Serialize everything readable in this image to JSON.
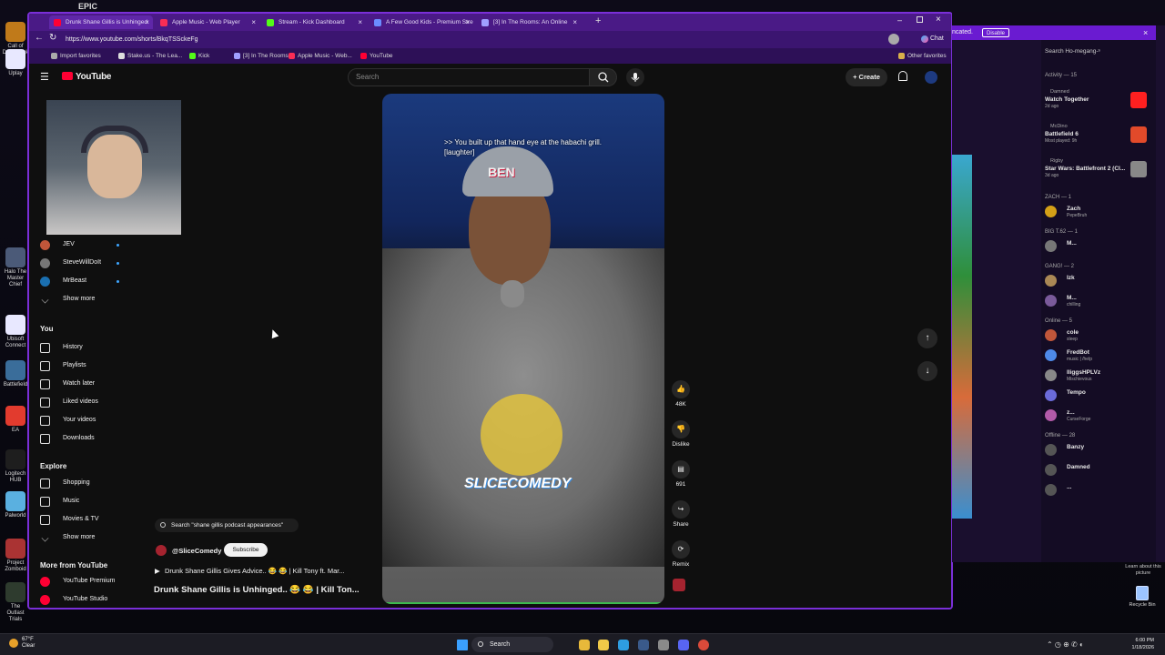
{
  "desktop": {
    "top_label": "EPIC",
    "icons": [
      {
        "label": "Call of Duty Black Ops",
        "color": "#c07a1a"
      },
      {
        "label": "Uplay",
        "color": "#e8e8ff"
      },
      {
        "label": "Halo The Master Chief",
        "color": "#4b5a78"
      },
      {
        "label": "Ubisoft Connect",
        "color": "#e8e8ff"
      },
      {
        "label": "Battlefield",
        "color": "#3a6d9a"
      },
      {
        "label": "EA",
        "color": "#e23b2e"
      },
      {
        "label": "Logitech HUB",
        "color": "#1e1e1e"
      },
      {
        "label": "Palworld",
        "color": "#5ab0e0"
      },
      {
        "label": "Project Zomboid",
        "color": "#a33"
      },
      {
        "label": "The Outlast Trials",
        "color": "#2e3b2e"
      }
    ],
    "recycle_bin": "Recycle Bin",
    "learn_more": "Learn about this picture"
  },
  "browser": {
    "tabs": [
      {
        "label": "Drunk Shane Gillis is Unhinged",
        "color": "#ff0033",
        "active": true
      },
      {
        "label": "Apple Music - Web Player",
        "color": "#fa2d55",
        "active": false
      },
      {
        "label": "Stream - Kick Dashboard",
        "color": "#53fc18",
        "active": false
      },
      {
        "label": "A Few Good Kids - Premium Stre",
        "color": "#6b8cff",
        "active": false
      },
      {
        "label": "[3] In The Rooms: An Online",
        "color": "#a0a0ff",
        "active": false
      }
    ],
    "url": "https://www.youtube.com/shorts/BkqTSSckeFg",
    "chat_label": "Chat",
    "bookmarks": [
      {
        "label": "Import favorites",
        "color": "#aaa"
      },
      {
        "label": "Stake.us - The Lea...",
        "color": "#ddd"
      },
      {
        "label": "Kick",
        "color": "#53fc18"
      },
      {
        "label": "[3] In The Rooms:...",
        "color": "#a0a0ff"
      },
      {
        "label": "Apple Music - Web...",
        "color": "#fa2d55"
      },
      {
        "label": "YouTube",
        "color": "#ff0033"
      }
    ],
    "other_favorites": "Other favorites"
  },
  "youtube": {
    "logo": "YouTube",
    "search_placeholder": "Search",
    "create_label": "Create",
    "subs": [
      {
        "name": "JEV",
        "color": "#c0563a"
      },
      {
        "name": "SteveWillDoIt",
        "color": "#777"
      },
      {
        "name": "MrBeast",
        "color": "#1a6fb0"
      }
    ],
    "show_more": "Show more",
    "you_label": "You",
    "you_items": [
      {
        "label": "History",
        "icon": "history-icon"
      },
      {
        "label": "Playlists",
        "icon": "playlists-icon"
      },
      {
        "label": "Watch later",
        "icon": "watch-later-icon"
      },
      {
        "label": "Liked videos",
        "icon": "liked-videos-icon"
      },
      {
        "label": "Your videos",
        "icon": "your-videos-icon"
      },
      {
        "label": "Downloads",
        "icon": "downloads-icon"
      }
    ],
    "explore_label": "Explore",
    "explore_items": [
      {
        "label": "Shopping"
      },
      {
        "label": "Music"
      },
      {
        "label": "Movies & TV"
      }
    ],
    "more_label": "More from YouTube",
    "more_items": [
      {
        "label": "YouTube Premium"
      },
      {
        "label": "YouTube Studio"
      }
    ],
    "related_search": "Search \"shane gillis podcast appearances\"",
    "channel": "@SliceComedy",
    "subscribe": "Subscribe",
    "related_video": "Drunk Shane Gillis Gives Advice.. 😂 😂 | Kill Tony ft. Mar...",
    "video_title": "Drunk Shane Gillis is Unhinged.. 😂 😂 | Kill Ton...",
    "caption": ">> You built up that hand eye at the habachi grill. [laughter]",
    "hat_text": "BEN",
    "watermark": "SLICECOMEDY",
    "actions": [
      {
        "label": "48K",
        "icon": "like-icon"
      },
      {
        "label": "Dislike",
        "icon": "dislike-icon"
      },
      {
        "label": "691",
        "icon": "comments-icon"
      },
      {
        "label": "Share",
        "icon": "share-icon"
      },
      {
        "label": "Remix",
        "icon": "remix-icon"
      }
    ]
  },
  "discord": {
    "notice": "ncated.",
    "disable": "Disable",
    "search": "Search Ho-megang-ˢ",
    "activity": "Activity — 15",
    "activities": [
      {
        "name": "Damned",
        "detail": "Watch Together",
        "sub": "2d ago",
        "color": "#ff2020"
      },
      {
        "name": "McDino",
        "detail": "Battlefield 6",
        "sub": "Most played: 9h",
        "color": "#e24a2a"
      },
      {
        "name": "Rigby",
        "detail": "Star Wars: Battlefront 2 (Cl...",
        "sub": "3d ago",
        "color": "#888"
      }
    ],
    "groups": [
      {
        "label": "ZACH — 1",
        "members": [
          {
            "name": "Zach",
            "status": "PepeBruh",
            "color": "#d4a017"
          }
        ]
      },
      {
        "label": "BIG T.62 — 1",
        "members": [
          {
            "name": "M...",
            "status": "",
            "color": "#777"
          }
        ]
      },
      {
        "label": "GANG! — 2",
        "members": [
          {
            "name": "Izk",
            "status": "",
            "color": "#aa8855"
          },
          {
            "name": "M...",
            "status": "chilling",
            "color": "#7a5a9a"
          }
        ]
      },
      {
        "label": "Online — 5",
        "members": [
          {
            "name": "cole",
            "status": "sleep",
            "color": "#c0563a"
          },
          {
            "name": "FredBot",
            "status": "music | /help",
            "color": "#4e8ae8"
          },
          {
            "name": "lliggsHPLVz",
            "status": "Mischievous",
            "color": "#888"
          },
          {
            "name": "Tempo",
            "status": "",
            "color": "#6b6bd9"
          },
          {
            "name": "z...",
            "status": "CurseForge",
            "color": "#b25aa8"
          }
        ]
      },
      {
        "label": "Offline — 28",
        "members": [
          {
            "name": "Banzy",
            "status": "",
            "color": "#555"
          },
          {
            "name": "Damned",
            "status": "",
            "color": "#555"
          },
          {
            "name": "...",
            "status": "",
            "color": "#555"
          }
        ]
      }
    ]
  },
  "taskbar": {
    "weather_temp": "67°F",
    "weather_cond": "Clear",
    "search": "Search",
    "time": "6:00 PM",
    "date": "1/18/2026"
  }
}
